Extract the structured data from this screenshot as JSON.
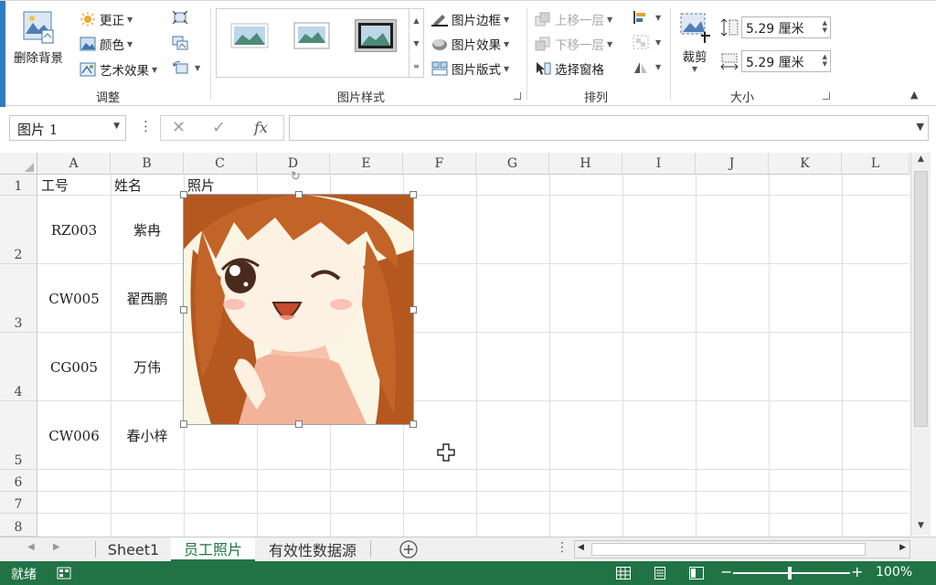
{
  "ribbon": {
    "adjust": {
      "remove_background": "删除背景",
      "corrections": "更正",
      "color": "颜色",
      "artistic_effects": "艺术效果",
      "group_label": "调整"
    },
    "picture_styles": {
      "border": "图片边框",
      "effects": "图片效果",
      "layout": "图片版式",
      "group_label": "图片样式"
    },
    "arrange": {
      "bring_forward": "上移一层",
      "send_backward": "下移一层",
      "selection_pane": "选择窗格",
      "group_label": "排列"
    },
    "size": {
      "crop": "裁剪",
      "height": "5.29 厘米",
      "width": "5.29 厘米",
      "group_label": "大小"
    }
  },
  "formula_bar": {
    "name_box": "图片 1",
    "fx": "fx",
    "value": ""
  },
  "columns": [
    "A",
    "B",
    "C",
    "D",
    "E",
    "F",
    "G",
    "H",
    "I",
    "J",
    "K",
    "L"
  ],
  "rows": [
    "1",
    "2",
    "3",
    "4",
    "5",
    "6",
    "7",
    "8"
  ],
  "table": {
    "headers": [
      "工号",
      "姓名",
      "照片"
    ],
    "records": [
      {
        "id": "RZ003",
        "name": "紫冉"
      },
      {
        "id": "CW005",
        "name": "翟西鹏"
      },
      {
        "id": "CG005",
        "name": "万伟"
      },
      {
        "id": "CW006",
        "name": "春小梓"
      }
    ]
  },
  "sheets": [
    "Sheet1",
    "员工照片",
    "有效性数据源"
  ],
  "active_sheet": "员工照片",
  "status": {
    "ready": "就绪",
    "zoom": "100%"
  },
  "colors": {
    "excel_green": "#217346",
    "ribbon_accent": "#2f7bbf"
  }
}
